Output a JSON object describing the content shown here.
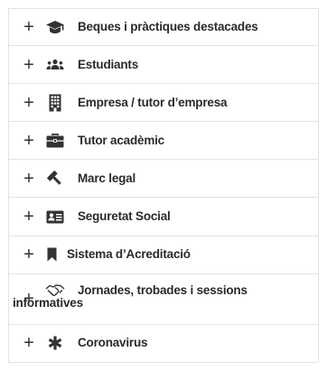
{
  "menu": {
    "items": [
      {
        "label": "Beques i pràctiques destacades",
        "icon": "graduation-cap-icon"
      },
      {
        "label": "Estudiants",
        "icon": "users-icon"
      },
      {
        "label": "Empresa / tutor d’empresa",
        "icon": "building-icon"
      },
      {
        "label": "Tutor acadèmic",
        "icon": "briefcase-icon"
      },
      {
        "label": "Marc legal",
        "icon": "gavel-icon"
      },
      {
        "label": "Seguretat Social",
        "icon": "id-card-icon"
      },
      {
        "label": "Sistema d’Acreditació",
        "icon": "bookmark-icon"
      },
      {
        "label_line1": "Jornades, trobades i sessions",
        "label_line2": "informatives",
        "icon": "handshake-icon"
      },
      {
        "label": "Coronavirus",
        "icon": "asterisk-icon"
      }
    ],
    "expand_symbol": "+",
    "icon_color": "#333333"
  }
}
